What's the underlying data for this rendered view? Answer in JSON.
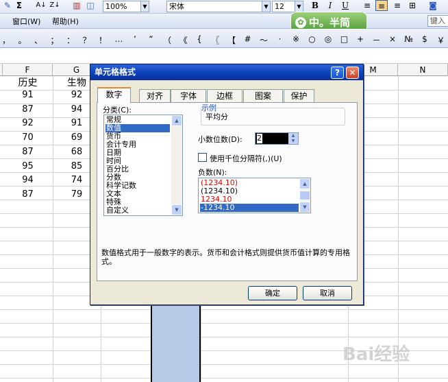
{
  "toolbar1": {
    "zoom": "100%",
    "font_name": "宋体",
    "font_size": "12",
    "bold": "B",
    "italic": "I",
    "underline": "U",
    "help_box_placeholder": "键入"
  },
  "menubar": {
    "window": "窗口(W)",
    "help": "帮助(H)"
  },
  "ime_badge": "中。半简",
  "symbols": [
    "，",
    "。",
    "、",
    "；",
    "：",
    "？",
    "！",
    "…",
    "‘",
    "“",
    "（",
    "《",
    "{",
    "〖",
    "【",
    "#",
    "～",
    "·",
    "※",
    "○",
    "◎",
    "□",
    "+",
    "－",
    "×",
    "№",
    "$",
    "￥"
  ],
  "sheet": {
    "columns": [
      "F",
      "G",
      "M",
      "N"
    ],
    "headers": {
      "F": "历史",
      "G": "生物"
    },
    "F": [
      "91",
      "87",
      "92",
      "70",
      "87",
      "95",
      "94",
      "87"
    ],
    "G": [
      "92",
      "94",
      "91",
      "69",
      "68",
      "85",
      "74",
      "79"
    ]
  },
  "dialog": {
    "title": "单元格格式",
    "help_btn": "?",
    "close_btn": "✕",
    "tabs": [
      "数字",
      "对齐",
      "字体",
      "边框",
      "图案",
      "保护"
    ],
    "category_label": "分类(C):",
    "categories": [
      "常规",
      "数值",
      "货币",
      "会计专用",
      "日期",
      "时间",
      "百分比",
      "分数",
      "科学记数",
      "文本",
      "特殊",
      "自定义"
    ],
    "selected_category": "数值",
    "sample_label": "示例",
    "sample_value": "平均分",
    "decimal_label": "小数位数(D):",
    "decimal_value": "2",
    "thousands_label": "使用千位分隔符(,)(U)",
    "thousands_checked": false,
    "negative_label": "负数(N):",
    "negative_options": [
      "(1234.10)",
      "(1234.10)",
      "1234.10",
      "-1234.10"
    ],
    "negative_selected": "-1234.10",
    "description": "数值格式用于一般数字的表示。货币和会计格式则提供货币值计算的专用格式。",
    "ok": "确定",
    "cancel": "取消"
  },
  "colors": {
    "red": "#e00000",
    "select": "#316ac5",
    "title": "#0a3fb4",
    "highlight_col": "#b8c9e5"
  },
  "watermark": "Bai经验"
}
